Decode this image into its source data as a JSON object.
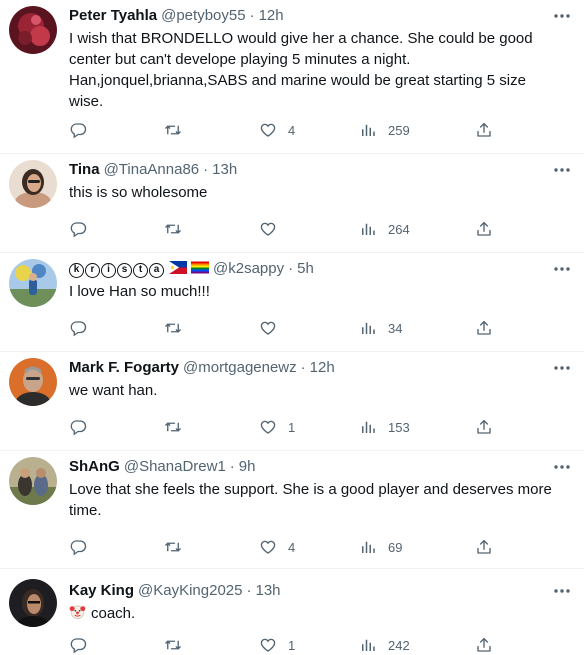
{
  "tweets": [
    {
      "name": "Peter Tyahla",
      "handle": "@petyboy55",
      "time": "12h",
      "text_lines": [
        "I wish that BRONDELLO would give her a chance. She could be good",
        "center but can't develope playing 5 minutes a night.",
        "Han,jonquel,brianna,SABS and marine would be great starting 5 size",
        "wise."
      ],
      "likes": "4",
      "views": "259"
    },
    {
      "name": "Tina",
      "handle": "@TinaAnna86",
      "time": "13h",
      "text_lines": [
        "this is so wholesome"
      ],
      "likes": "",
      "views": "264"
    },
    {
      "name_letters": [
        "k",
        "r",
        "i",
        "s",
        "t",
        "a"
      ],
      "flags": [
        "philippines-flag",
        "rainbow-flag"
      ],
      "handle": "@k2sappy",
      "time": "5h",
      "text_lines": [
        "I love Han so much!!!"
      ],
      "likes": "",
      "views": "34"
    },
    {
      "name": "Mark F. Fogarty",
      "handle": "@mortgagenewz",
      "time": "12h",
      "text_lines": [
        "we want han."
      ],
      "likes": "1",
      "views": "153"
    },
    {
      "name": "ShAnG",
      "handle": "@ShanaDrew1",
      "time": "9h",
      "text_lines": [
        "Love that she feels the support. She is a good player and deserves more",
        "time."
      ],
      "likes": "4",
      "views": "69"
    },
    {
      "name": "Kay King",
      "handle": "@KayKing2025",
      "time": "13h",
      "emoji": "clown-face-emoji",
      "text_lines": [
        "coach."
      ],
      "likes": "1",
      "views": "242"
    }
  ],
  "separator": "·",
  "icons": {
    "reply": "reply-icon",
    "retweet": "retweet-icon",
    "like": "heart-icon",
    "views": "views-icon",
    "share": "share-icon",
    "more": "more-icon"
  },
  "colors": {
    "text": "#0f1419",
    "secondary": "#536471",
    "border": "#eff3f4"
  }
}
